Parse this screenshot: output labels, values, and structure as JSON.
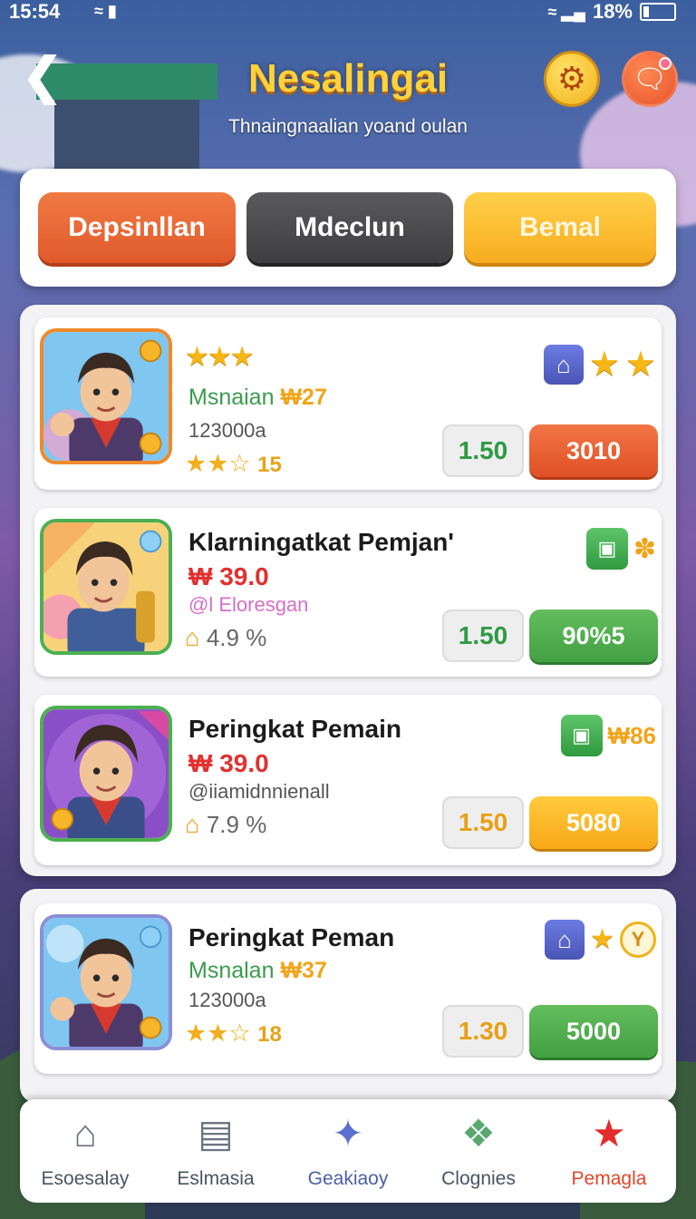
{
  "status_bar": {
    "time": "15:54",
    "battery": "18%"
  },
  "header": {
    "title": "Nesalingai",
    "subtitle": "Thnaingnaalian yoand oulan",
    "back_icon": "chevron-left-icon",
    "settings_icon": "gear-icon",
    "chat_icon": "chat-bubble-icon"
  },
  "tabs": [
    {
      "label": "Depsinllan",
      "color": "#e8602f"
    },
    {
      "label": "Mdeclun",
      "color": "#4a4a4c"
    },
    {
      "label": "Bemal",
      "color": "#f7b52a"
    }
  ],
  "cards": [
    {
      "line_a_label": "Msnaian",
      "line_a_value": "₩27",
      "line_b": "123000a",
      "line_c_value": "15",
      "value_box": "1.50",
      "action": "3010",
      "badges": [
        "home-icon",
        "star-icon",
        "star-icon"
      ]
    },
    {
      "title": "Klarningatkat Pemjan'",
      "price": "₩ 39.0",
      "handle": "@l Eloresgan",
      "percent": "4.9 %",
      "value_box": "1.50",
      "action": "90%5",
      "badges": [
        "gift-box-icon",
        "fire-icon"
      ]
    },
    {
      "title": "Peringkat Pemain",
      "price": "₩ 39.0",
      "handle": "@iiamidnnienall",
      "percent": "7.9 %",
      "value_box": "1.50",
      "action": "5080",
      "badge_num": "₩86",
      "badges": [
        "gift-box-icon"
      ]
    },
    {
      "title": "Peringkat Peman",
      "line_a_label": "Msnalan",
      "line_a_value": "₩37",
      "line_b": "123000a",
      "line_c_value": "18",
      "value_box": "1.30",
      "action": "5000",
      "badges": [
        "home-icon",
        "star-icon",
        "clock-icon"
      ]
    }
  ],
  "bottom_nav": [
    {
      "label": "Esoesalay",
      "icon": "home-icon"
    },
    {
      "label": "Eslmasia",
      "icon": "document-icon"
    },
    {
      "label": "Geakiaoy",
      "icon": "rocket-icon"
    },
    {
      "label": "Clognies",
      "icon": "badge-icon"
    },
    {
      "label": "Pemagla",
      "icon": "star-icon"
    }
  ]
}
